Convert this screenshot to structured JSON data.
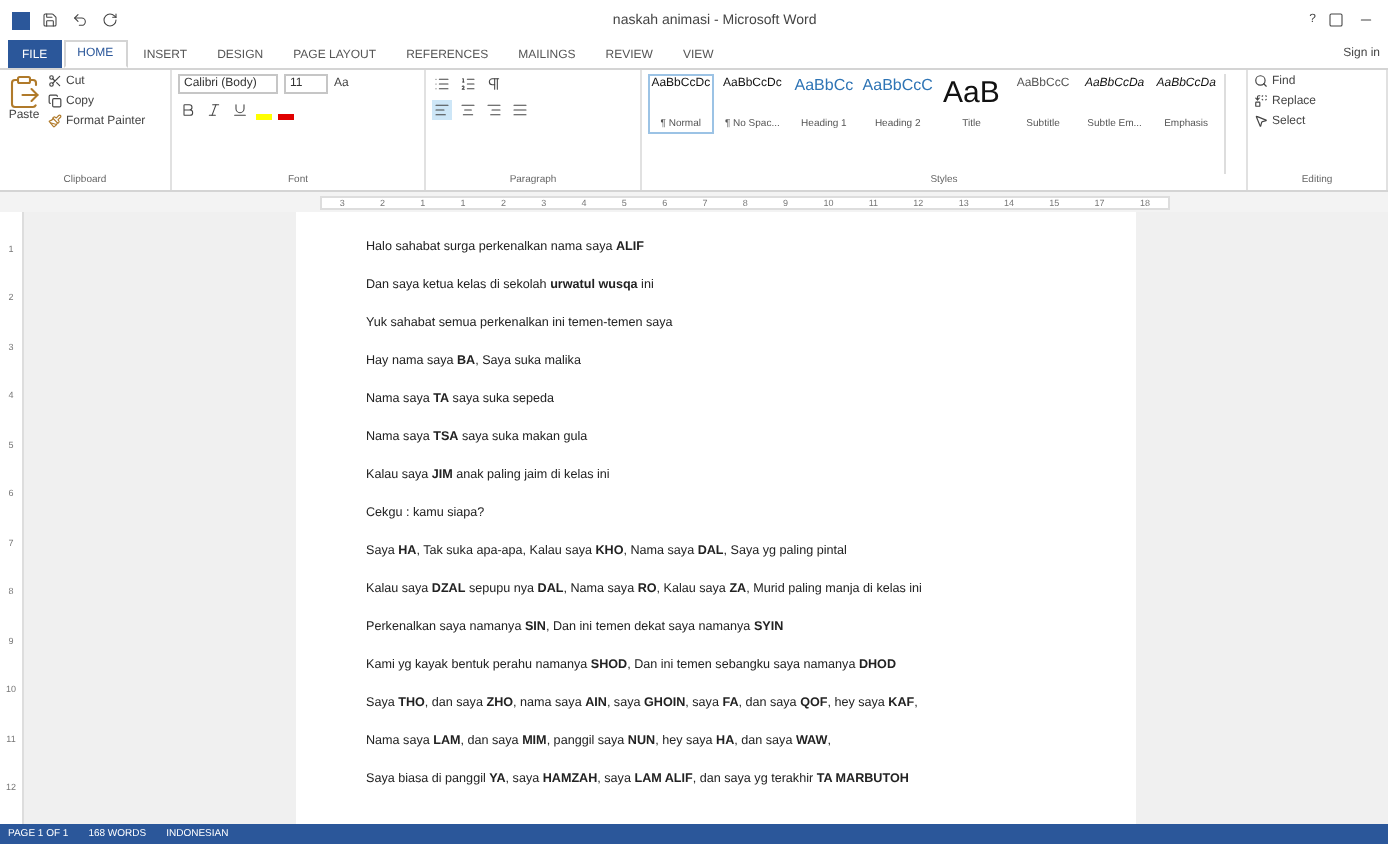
{
  "window": {
    "title": "naskah animasi - Microsoft Word",
    "controls": [
      "?"
    ],
    "sign_in": "Sign in"
  },
  "tabs": [
    {
      "label": "FILE",
      "kind": "file",
      "selected": false
    },
    {
      "label": "HOME",
      "kind": "tab",
      "selected": true
    },
    {
      "label": "INSERT",
      "kind": "tab",
      "selected": false
    },
    {
      "label": "DESIGN",
      "kind": "tab",
      "selected": false
    },
    {
      "label": "PAGE LAYOUT",
      "kind": "tab",
      "selected": false
    },
    {
      "label": "REFERENCES",
      "kind": "tab",
      "selected": false
    },
    {
      "label": "MAILINGS",
      "kind": "tab",
      "selected": false
    },
    {
      "label": "REVIEW",
      "kind": "tab",
      "selected": false
    },
    {
      "label": "VIEW",
      "kind": "tab",
      "selected": false
    }
  ],
  "clipboard": {
    "paste": "Paste",
    "cut": "Cut",
    "copy": "Copy",
    "format_painter": "Format Painter",
    "label": "Clipboard"
  },
  "font": {
    "name": "Calibri (Body)",
    "size": "11",
    "case": "Aa",
    "label": "Font"
  },
  "paragraph": {
    "label": "Paragraph",
    "align_left_selected": true
  },
  "styles": {
    "label": "Styles",
    "items": [
      {
        "preview": "AaBbCcDc",
        "name": "¶ Normal",
        "selected": true
      },
      {
        "preview": "AaBbCcDc",
        "name": "¶ No Spac...",
        "selected": false
      },
      {
        "preview": "AaBbCc",
        "name": "Heading 1",
        "selected": false
      },
      {
        "preview": "AaBbCcC",
        "name": "Heading 2",
        "selected": false
      },
      {
        "preview": "AaB",
        "name": "Title",
        "selected": false
      },
      {
        "preview": "AaBbCcC",
        "name": "Subtitle",
        "selected": false
      },
      {
        "preview": "AaBbCcDa",
        "name": "Subtle Em...",
        "selected": false
      },
      {
        "preview": "AaBbCcDa",
        "name": "Emphasis",
        "selected": false
      }
    ]
  },
  "editing": {
    "label": "Editing",
    "find": "Find",
    "replace": "Replace",
    "select": "Select"
  },
  "ruler": {
    "marks": [
      "3",
      "2",
      "1",
      "1",
      "2",
      "3",
      "4",
      "5",
      "6",
      "7",
      "8",
      "9",
      "10",
      "11",
      "12",
      "13",
      "14",
      "15",
      "17",
      "18"
    ],
    "vertical": [
      "1",
      "2",
      "3",
      "4",
      "5",
      "6",
      "7",
      "8",
      "9",
      "10",
      "11",
      "12"
    ]
  },
  "document": {
    "paragraphs": [
      "Halo sahabat surga perkenalkan nama saya **ALIF**",
      "Dan saya ketua kelas di sekolah **urwatul wusqa** ini",
      "Yuk sahabat semua perkenalkan ini temen-temen saya",
      "Hay nama saya **BA**, Saya suka malika",
      "Nama saya **TA** saya suka sepeda",
      "Nama saya **TSA** saya suka makan gula",
      "Kalau saya **JIM** anak paling jaim di kelas ini",
      "Cekgu : kamu siapa?",
      "Saya **HA**, Tak suka apa-apa, Kalau saya **KHO**, Nama saya **DAL**, Saya yg paling pintal",
      "Kalau saya **DZAL** sepupu nya **DAL**, Nama saya **RO**, Kalau saya **ZA**, Murid paling manja di kelas ini",
      "Perkenalkan saya namanya **SIN**, Dan ini temen dekat saya namanya **SYIN**",
      "Kami yg kayak bentuk perahu namanya **SHOD**, Dan ini temen sebangku saya namanya **DHOD**",
      "Saya **THO**, dan saya **ZHO**, nama saya **AIN**, saya **GHOIN**, saya **FA**, dan saya **QOF**, hey saya **KAF**,",
      "Nama saya **LAM**, dan saya **MIM**, panggil saya **NUN**, hey saya **HA**, dan saya **WAW**,",
      "Saya biasa di panggil **YA**, saya **HAMZAH**, saya **LAM ALIF**, dan saya yg terakhir **TA MARBUTOH**"
    ]
  },
  "status_bar": {
    "page": "PAGE 1 OF 1",
    "words": "168 WORDS",
    "language": "INDONESIAN"
  }
}
